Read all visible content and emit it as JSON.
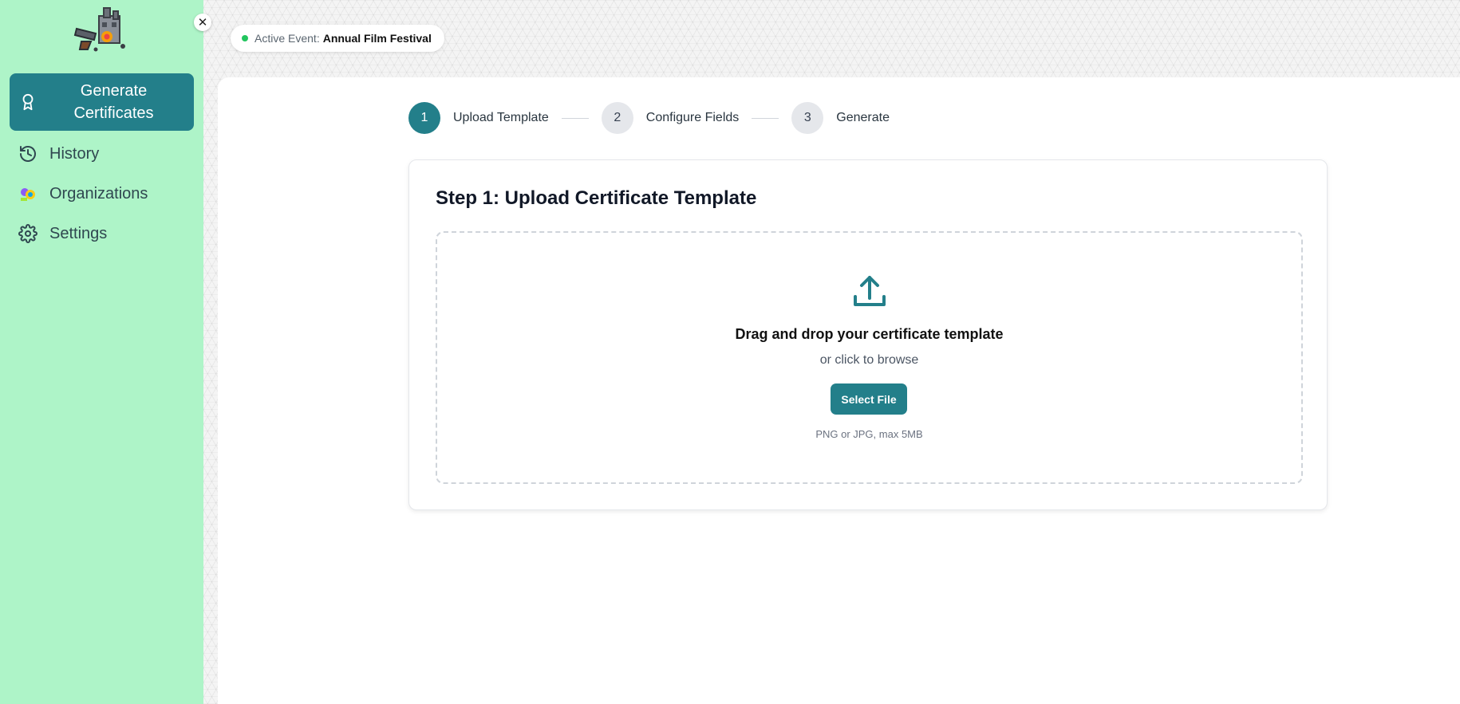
{
  "sidebar": {
    "close_label": "✕",
    "items": [
      {
        "label": "Generate Certificates",
        "icon": "award-icon",
        "active": true
      },
      {
        "label": "History",
        "icon": "history-icon"
      },
      {
        "label": "Organizations",
        "icon": "organizations-icon"
      },
      {
        "label": "Settings",
        "icon": "gear-icon"
      }
    ]
  },
  "header": {
    "event_prefix": "Active Event:",
    "event_name": "Annual Film Festival",
    "status_color": "#22c55e"
  },
  "stepper": {
    "steps": [
      {
        "number": "1",
        "label": "Upload Template",
        "active": true
      },
      {
        "number": "2",
        "label": "Configure Fields",
        "active": false
      },
      {
        "number": "3",
        "label": "Generate",
        "active": false
      }
    ]
  },
  "upload": {
    "title": "Step 1: Upload Certificate Template",
    "drop_title": "Drag and drop your certificate template",
    "drop_subtitle": "or click to browse",
    "button_label": "Select File",
    "hint": "PNG or JPG, max 5MB"
  },
  "colors": {
    "accent": "#237f8a",
    "sidebar_bg": "#aef4c8"
  }
}
